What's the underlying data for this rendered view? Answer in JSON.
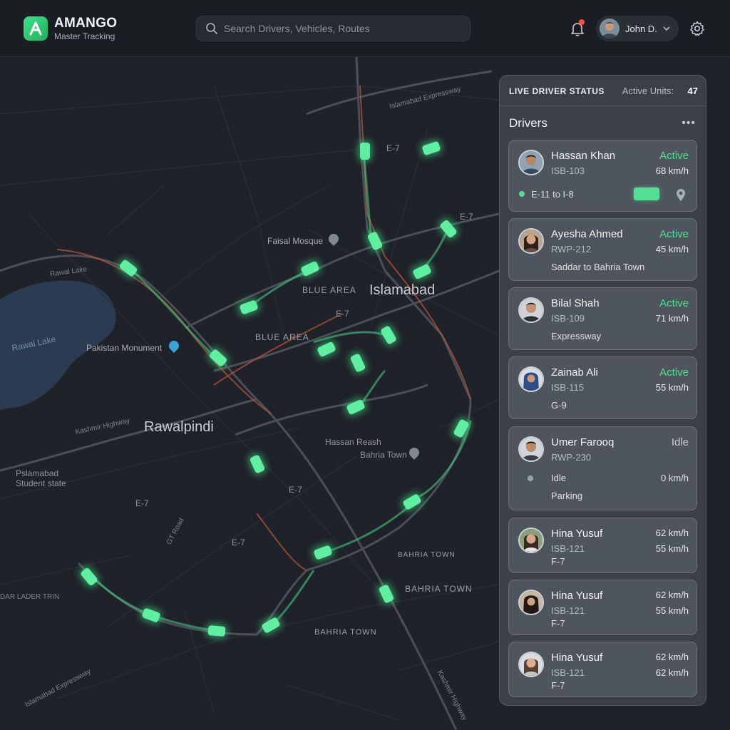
{
  "header": {
    "brand_name": "AMANGO",
    "brand_sub": "Master Tracking",
    "search_placeholder": "Search Drivers, Vehicles, Routes",
    "user_name": "John D."
  },
  "map": {
    "labels": {
      "islamabad": "Islamabad",
      "rawalpindi": "Rawalpindi",
      "faisal_mosque": "Faisal Mosque",
      "pakistan_monument": "Pakistan Monument",
      "rawal_lake": "Rawal Lake",
      "rawal_lake_road": "Rawal Lake",
      "blue_area_1": "BLUE AREA",
      "blue_area_2": "BLUE AREA",
      "e7_1": "E-7",
      "e7_2": "E-7",
      "e7_3": "E-7",
      "e7_4": "E-7",
      "e7_5": "E-7",
      "e7_6": "E-7",
      "hassan_reash": "Hassan Reash",
      "bahria_town_poi": "Bahria Town",
      "bahria_town_1": "BAHRIA TOWN",
      "bahria_town_2": "BAHRIA TOWN",
      "bahria_town_3": "BAHRIA TOWN",
      "islamabad_expressway": "Islamabad Expressway",
      "islamabad_expressway_2": "Islamabad Expressway",
      "kashmir_highway": "Kashmir Highway",
      "kashmir_highway_2": "Kashmir Highway",
      "gt_road": "GT Road",
      "student_state": "Pslamabad\nStudent state",
      "lader_trin": "DAR LADER TRIN"
    }
  },
  "panel": {
    "title": "LIVE DRIVER STATUS",
    "units_label": "Active Units:",
    "units_value": "47",
    "drivers_title": "Drivers",
    "more": "•••",
    "drivers": [
      {
        "name": "Hassan Khan",
        "plate": "ISB-103",
        "status": "Active",
        "speed": "68 km/h",
        "route": "E-11 to I-8"
      },
      {
        "name": "Ayesha Ahmed",
        "plate": "RWP-212",
        "status": "Active",
        "speed": "45 km/h",
        "route": "Saddar to Bahria Town"
      },
      {
        "name": "Bilal Shah",
        "plate": "ISB-109",
        "status": "Active",
        "speed": "71 km/h",
        "route": "Expressway"
      },
      {
        "name": "Zainab Ali",
        "plate": "ISB-115",
        "status": "Active",
        "speed": "55 km/h",
        "route": "G-9"
      },
      {
        "name": "Umer Farooq",
        "plate": "RWP-230",
        "status": "Idle",
        "idle_label": "Idle",
        "speed": "0 km/h",
        "route": "Parking"
      },
      {
        "name": "Hina Yusuf",
        "plate": "ISB-121",
        "speed_1": "62 km/h",
        "speed_2": "55 km/h",
        "route": "F-7"
      },
      {
        "name": "Hina Yusuf",
        "plate": "ISB-121",
        "speed_1": "62 km/h",
        "speed_2": "55 km/h",
        "route": "F-7"
      },
      {
        "name": "Hina Yusuf",
        "plate": "ISB-121",
        "speed_1": "62 km/h",
        "speed_2": "62 km/h",
        "route": "F-7"
      }
    ]
  },
  "colors": {
    "active": "#4fe08e",
    "idle": "#c9cdd2",
    "vehicle": "#5ef0a0",
    "brand": "#2fcf78"
  },
  "icons": {
    "logo": "logo-a-icon",
    "search": "search-icon",
    "bell": "bell-icon",
    "chevron": "chevron-down-icon",
    "settings": "gear-icon",
    "more": "more-dots-icon",
    "van": "van-icon",
    "pin": "map-pin-icon"
  }
}
